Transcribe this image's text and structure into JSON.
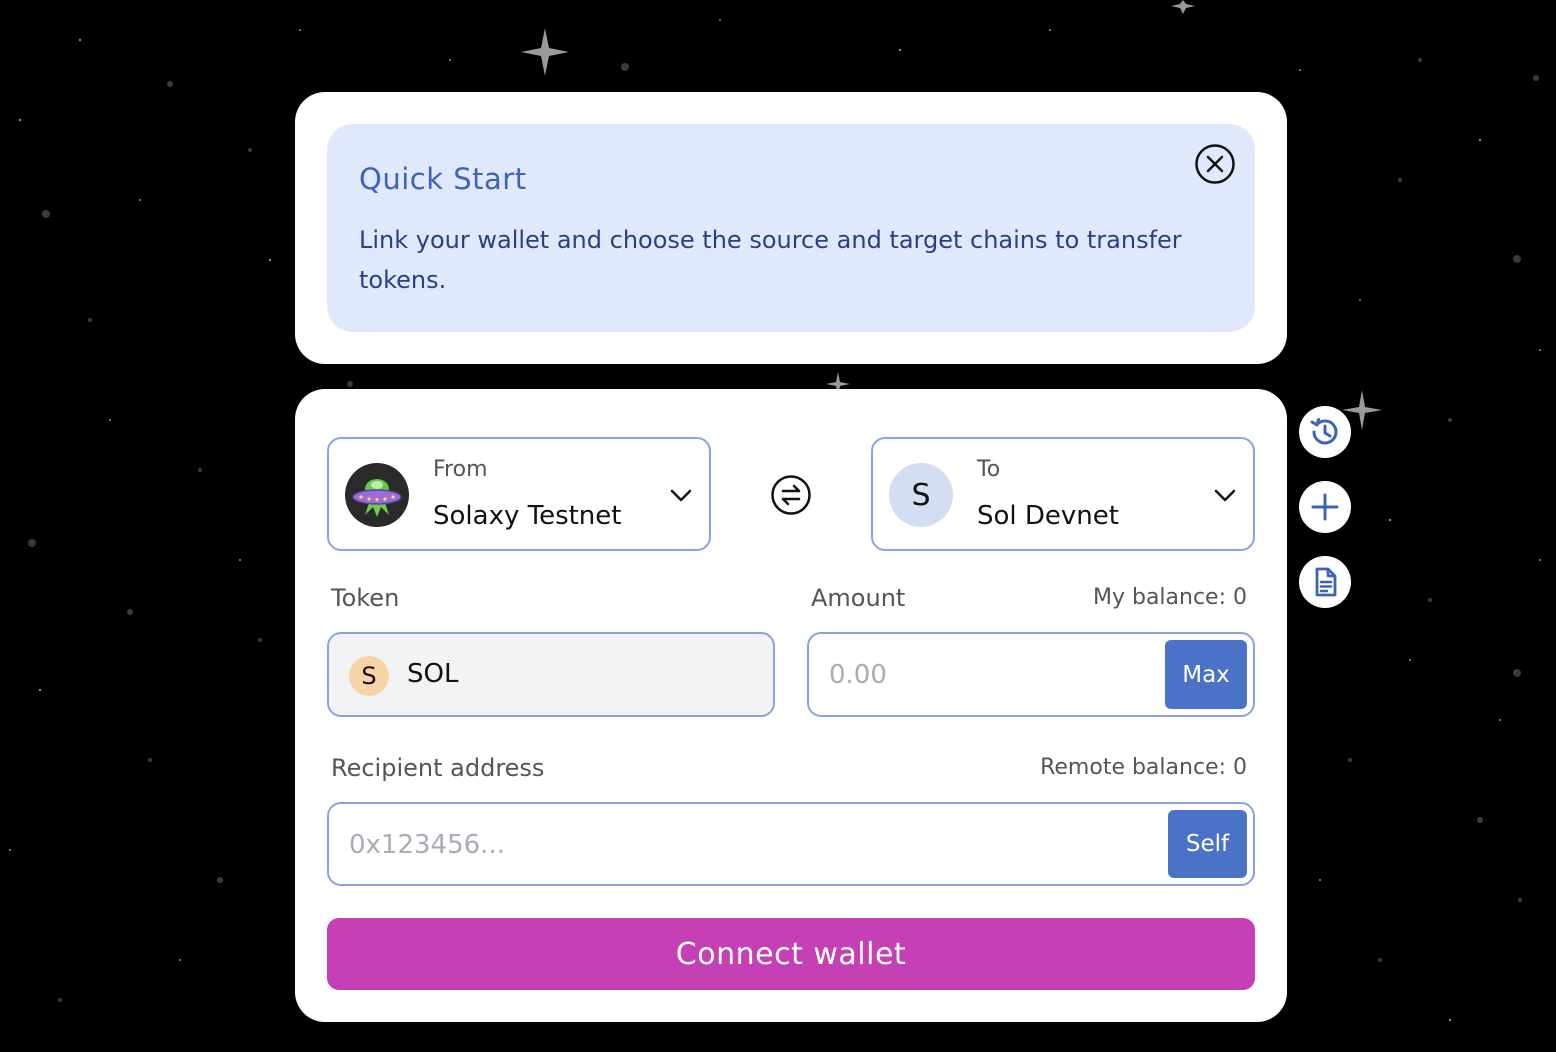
{
  "quick_start": {
    "title": "Quick Start",
    "text": "Link your wallet and choose the source and target chains to transfer tokens."
  },
  "from": {
    "label": "From",
    "chain": "Solaxy Testnet",
    "icon": "ufo-logo-icon"
  },
  "to": {
    "label": "To",
    "chain": "Sol Devnet",
    "icon_letter": "S"
  },
  "token": {
    "label": "Token",
    "icon_letter": "S",
    "symbol": "SOL"
  },
  "amount": {
    "label": "Amount",
    "balance_text": "My balance: 0",
    "placeholder": "0.00",
    "max_label": "Max"
  },
  "recipient": {
    "label": "Recipient address",
    "balance_text": "Remote balance: 0",
    "placeholder": "0x123456...",
    "self_label": "Self"
  },
  "connect_label": "Connect wallet",
  "side_actions": [
    "history-icon",
    "plus-icon",
    "document-icon"
  ],
  "colors": {
    "accent": "#4a72c6",
    "connect": "#c440b4",
    "info_bg": "#dfe9fb",
    "info_text": "#2b3f86"
  }
}
